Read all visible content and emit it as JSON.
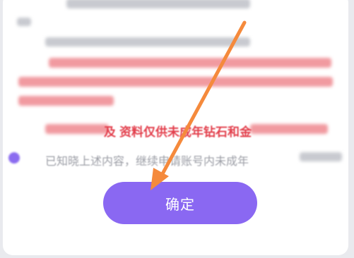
{
  "notice": {
    "highlight_text": "资料仅供未成年钻石和金",
    "highlight_prefix": "及",
    "acknowledge_text": "已知晓上述内容，继续申请账号内未成年"
  },
  "confirm_button": {
    "label": "确定"
  },
  "colors": {
    "button": "#8a68f2",
    "arrow": "#f58a3c",
    "warning": "#e23d4a"
  }
}
